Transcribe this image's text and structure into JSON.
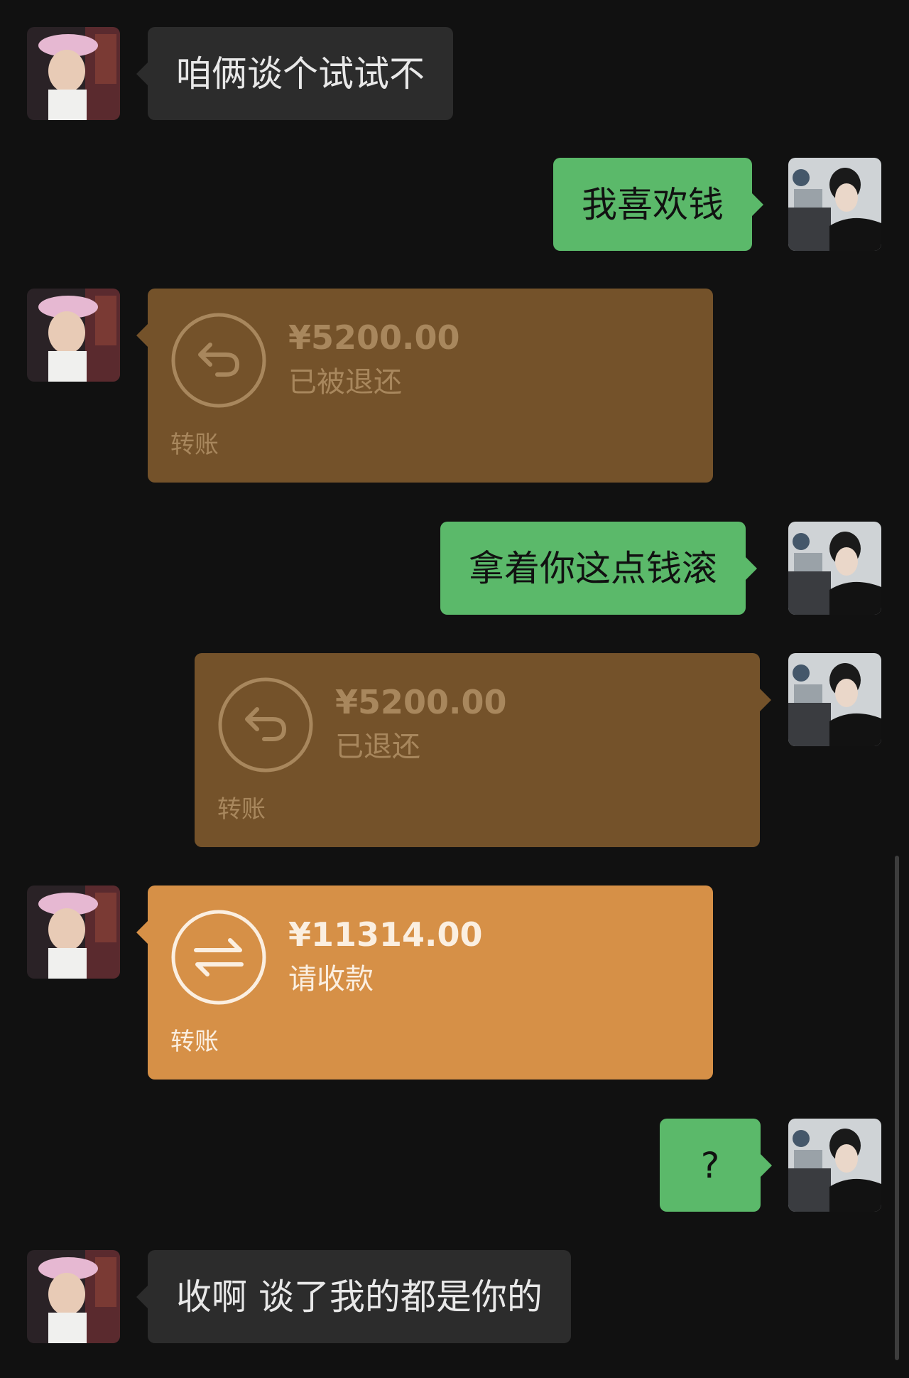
{
  "conversation": {
    "messages": [
      {
        "type": "text",
        "side": "incoming",
        "text": "咱俩谈个试试不"
      },
      {
        "type": "text",
        "side": "outgoing",
        "text": "我喜欢钱"
      },
      {
        "type": "transfer",
        "side": "incoming",
        "amount": "¥5200.00",
        "status": "已被退还",
        "label": "转账",
        "state": "returned"
      },
      {
        "type": "text",
        "side": "outgoing",
        "text": "拿着你这点钱滚"
      },
      {
        "type": "transfer",
        "side": "outgoing",
        "amount": "¥5200.00",
        "status": "已退还",
        "label": "转账",
        "state": "returned"
      },
      {
        "type": "transfer",
        "side": "incoming",
        "amount": "¥11314.00",
        "status": "请收款",
        "label": "转账",
        "state": "pending"
      },
      {
        "type": "text",
        "side": "outgoing",
        "text": "?"
      },
      {
        "type": "text",
        "side": "incoming",
        "text": "收啊 谈了我的都是你的"
      }
    ]
  },
  "icons": {
    "returned_transfer": "return-arrow-icon",
    "pending_transfer": "transfer-arrows-icon"
  },
  "colors": {
    "background": "#111111",
    "incoming_bubble": "#2c2c2c",
    "outgoing_bubble": "#5bb96a",
    "returned_transfer": "#74522a",
    "pending_transfer": "#d69047"
  }
}
